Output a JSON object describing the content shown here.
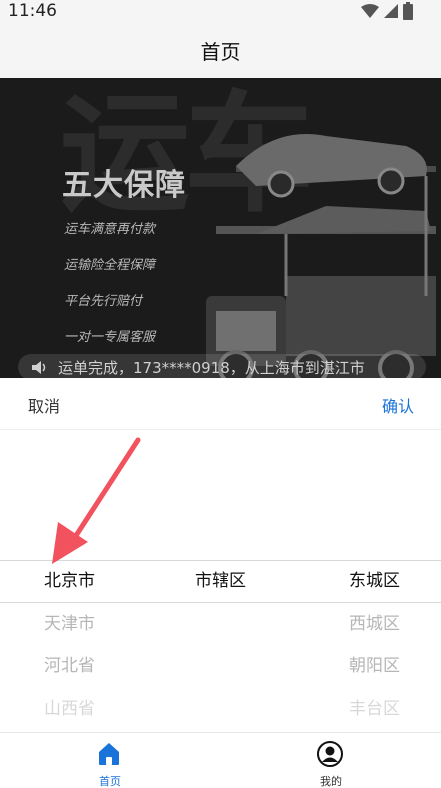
{
  "status_bar": {
    "time": "11:46"
  },
  "header": {
    "title": "首页"
  },
  "banner": {
    "bg_text": "运车",
    "headline": "五大保障",
    "lines": [
      "运车满意再付款",
      "运输险全程保障",
      "平台先行赔付",
      "一对一专属客服"
    ],
    "notice": "运单完成，173****0918，从上海市到湛江市"
  },
  "picker": {
    "cancel": "取消",
    "confirm": "确认",
    "province": [
      "北京市",
      "天津市",
      "河北省",
      "山西省"
    ],
    "city": [
      "市辖区"
    ],
    "district": [
      "东城区",
      "西城区",
      "朝阳区",
      "丰台区"
    ]
  },
  "tab_bar": {
    "items": [
      {
        "label": "首页",
        "icon": "home-icon"
      },
      {
        "label": "我的",
        "icon": "profile-icon"
      }
    ],
    "active_color": "#1a73d9"
  }
}
